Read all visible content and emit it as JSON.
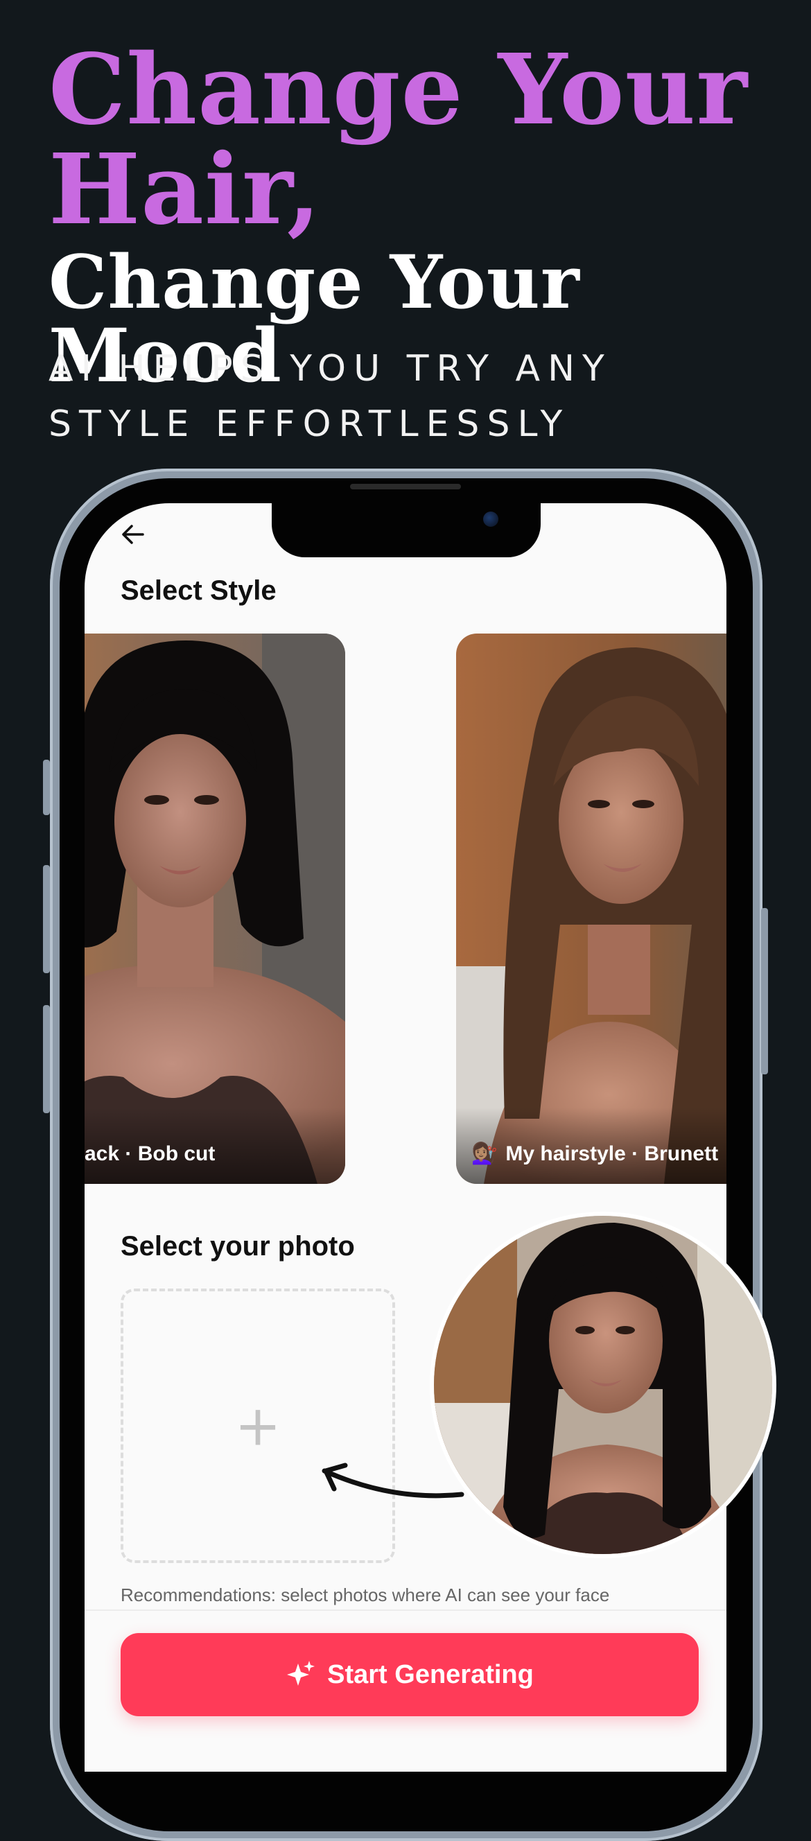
{
  "headline": {
    "line1": "Change Your",
    "line2": "Hair,",
    "line3": "Change Your Mood",
    "subtitle": "AI HELPS YOU TRY ANY STYLE EFFORTLESSLY"
  },
  "screen": {
    "back_icon": "arrow-left-icon",
    "style_section_title": "Select Style",
    "styles": [
      {
        "label": "Black · Bob cut",
        "visible_label": "ack · Bob cut"
      },
      {
        "emoji": "💇🏽‍♀️",
        "label": "My hairstyle · Brunett"
      }
    ],
    "photo_section_title": "Select your photo",
    "upload_plus": "+",
    "recommendation": "Recommendations: select photos where AI can see your face",
    "cta_label": "Start Generating",
    "cta_icon": "sparkle-icon"
  },
  "colors": {
    "background": "#12181c",
    "accent_purple": "#c86ae0",
    "cta_red": "#ff3b58"
  }
}
